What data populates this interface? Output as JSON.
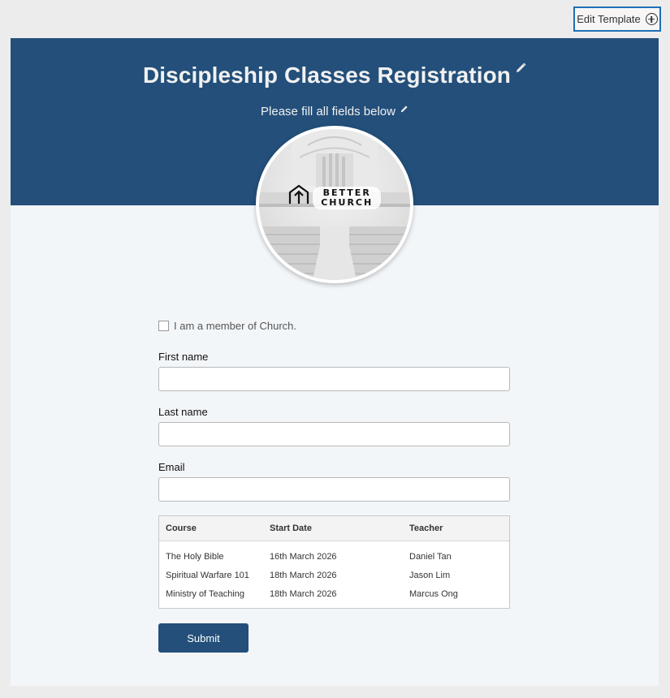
{
  "toolbar": {
    "edit_template_label": "Edit Template"
  },
  "colors": {
    "header": "#234f7a",
    "submit": "#234f7a",
    "edit_border": "#1f6fb5"
  },
  "header": {
    "title": "Discipleship Classes Registration",
    "subtitle": "Please fill all fields below"
  },
  "logo": {
    "line1": "BETTER",
    "line2": "CHURCH"
  },
  "form": {
    "member_checkbox_label": "I am a member of Church.",
    "member_checked": false,
    "first_name": {
      "label": "First name",
      "value": ""
    },
    "last_name": {
      "label": "Last name",
      "value": ""
    },
    "email": {
      "label": "Email",
      "value": ""
    },
    "table": {
      "headers": [
        "Course",
        "Start Date",
        "Teacher"
      ],
      "rows": [
        [
          "The Holy Bible",
          "16th March 2026",
          "Daniel Tan"
        ],
        [
          "Spiritual Warfare 101",
          "18th March 2026",
          "Jason Lim"
        ],
        [
          "Ministry of Teaching",
          "18th March 2026",
          "Marcus Ong"
        ]
      ]
    },
    "submit_label": "Submit"
  },
  "icons": [
    "plus-circle-icon",
    "pencil-icon",
    "church-logo-icon"
  ]
}
